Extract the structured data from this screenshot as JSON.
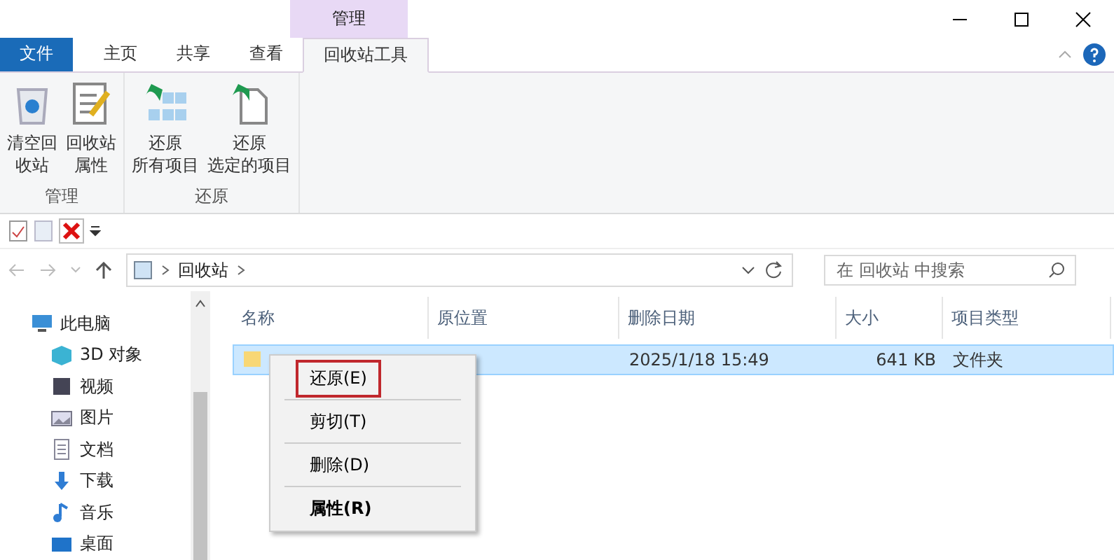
{
  "contextual_tab": {
    "label": "管理"
  },
  "ribbon_tabs": [
    {
      "label": "文件",
      "kind": "file",
      "selected": false
    },
    {
      "label": "主页",
      "kind": "tab",
      "selected": false
    },
    {
      "label": "共享",
      "kind": "tab",
      "selected": false
    },
    {
      "label": "查看",
      "kind": "tab",
      "selected": false
    },
    {
      "label": "回收站工具",
      "kind": "tab",
      "selected": true
    }
  ],
  "ribbon_groups": [
    {
      "label": "管理",
      "buttons": [
        {
          "label": "清空回收站"
        },
        {
          "label": "回收站属性"
        }
      ]
    },
    {
      "label": "还原",
      "buttons": [
        {
          "label": "还原所有项目"
        },
        {
          "label": "还原选定的项目"
        }
      ]
    }
  ],
  "address": {
    "path": "回收站"
  },
  "search": {
    "placeholder": "在 回收站 中搜索"
  },
  "sidebar": {
    "items": [
      {
        "label": "此电脑",
        "children": [
          {
            "label": "3D 对象"
          },
          {
            "label": "视频"
          },
          {
            "label": "图片"
          },
          {
            "label": "文档"
          },
          {
            "label": "下载"
          },
          {
            "label": "音乐"
          },
          {
            "label": "桌面"
          }
        ]
      }
    ]
  },
  "table": {
    "columns": [
      {
        "label": "名称"
      },
      {
        "label": "原位置"
      },
      {
        "label": "删除日期"
      },
      {
        "label": "大小"
      },
      {
        "label": "项目类型"
      }
    ],
    "rows": [
      {
        "selected": true,
        "cells": [
          "",
          "",
          "2025/1/18 15:49",
          "641 KB",
          "文件夹"
        ]
      }
    ]
  },
  "context_menu": {
    "items": [
      {
        "label": "还原(E)",
        "bold": false,
        "highlighted": true
      },
      {
        "label": "剪切(T)",
        "bold": false,
        "highlighted": false
      },
      {
        "label": "删除(D)",
        "bold": false,
        "highlighted": false
      },
      {
        "label": "属性(R)",
        "bold": true,
        "highlighted": false
      }
    ]
  }
}
